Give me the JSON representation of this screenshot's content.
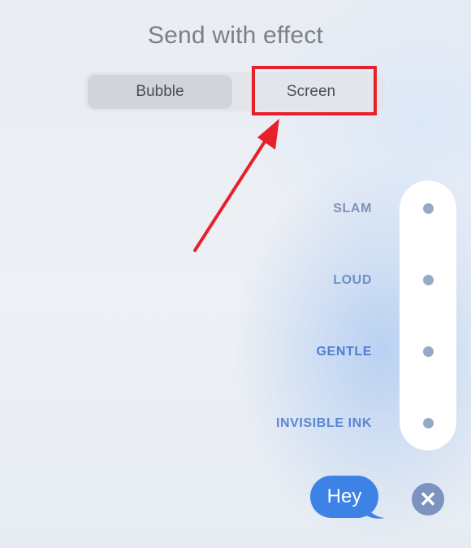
{
  "header": {
    "title": "Send with effect"
  },
  "segmented": {
    "bubble_label": "Bubble",
    "screen_label": "Screen",
    "selected": "Bubble"
  },
  "effects": [
    {
      "label": "SLAM",
      "color": "#7f93b6"
    },
    {
      "label": "LOUD",
      "color": "#6f8fc6"
    },
    {
      "label": "GENTLE",
      "color": "#4e7ed0"
    },
    {
      "label": "INVISIBLE INK",
      "color": "#5a86d2"
    }
  ],
  "message": {
    "text": "Hey",
    "bubble_color": "#3d83e6"
  },
  "close_icon": "close-x-icon",
  "annotation": {
    "color": "#e8202a",
    "target": "Screen"
  }
}
